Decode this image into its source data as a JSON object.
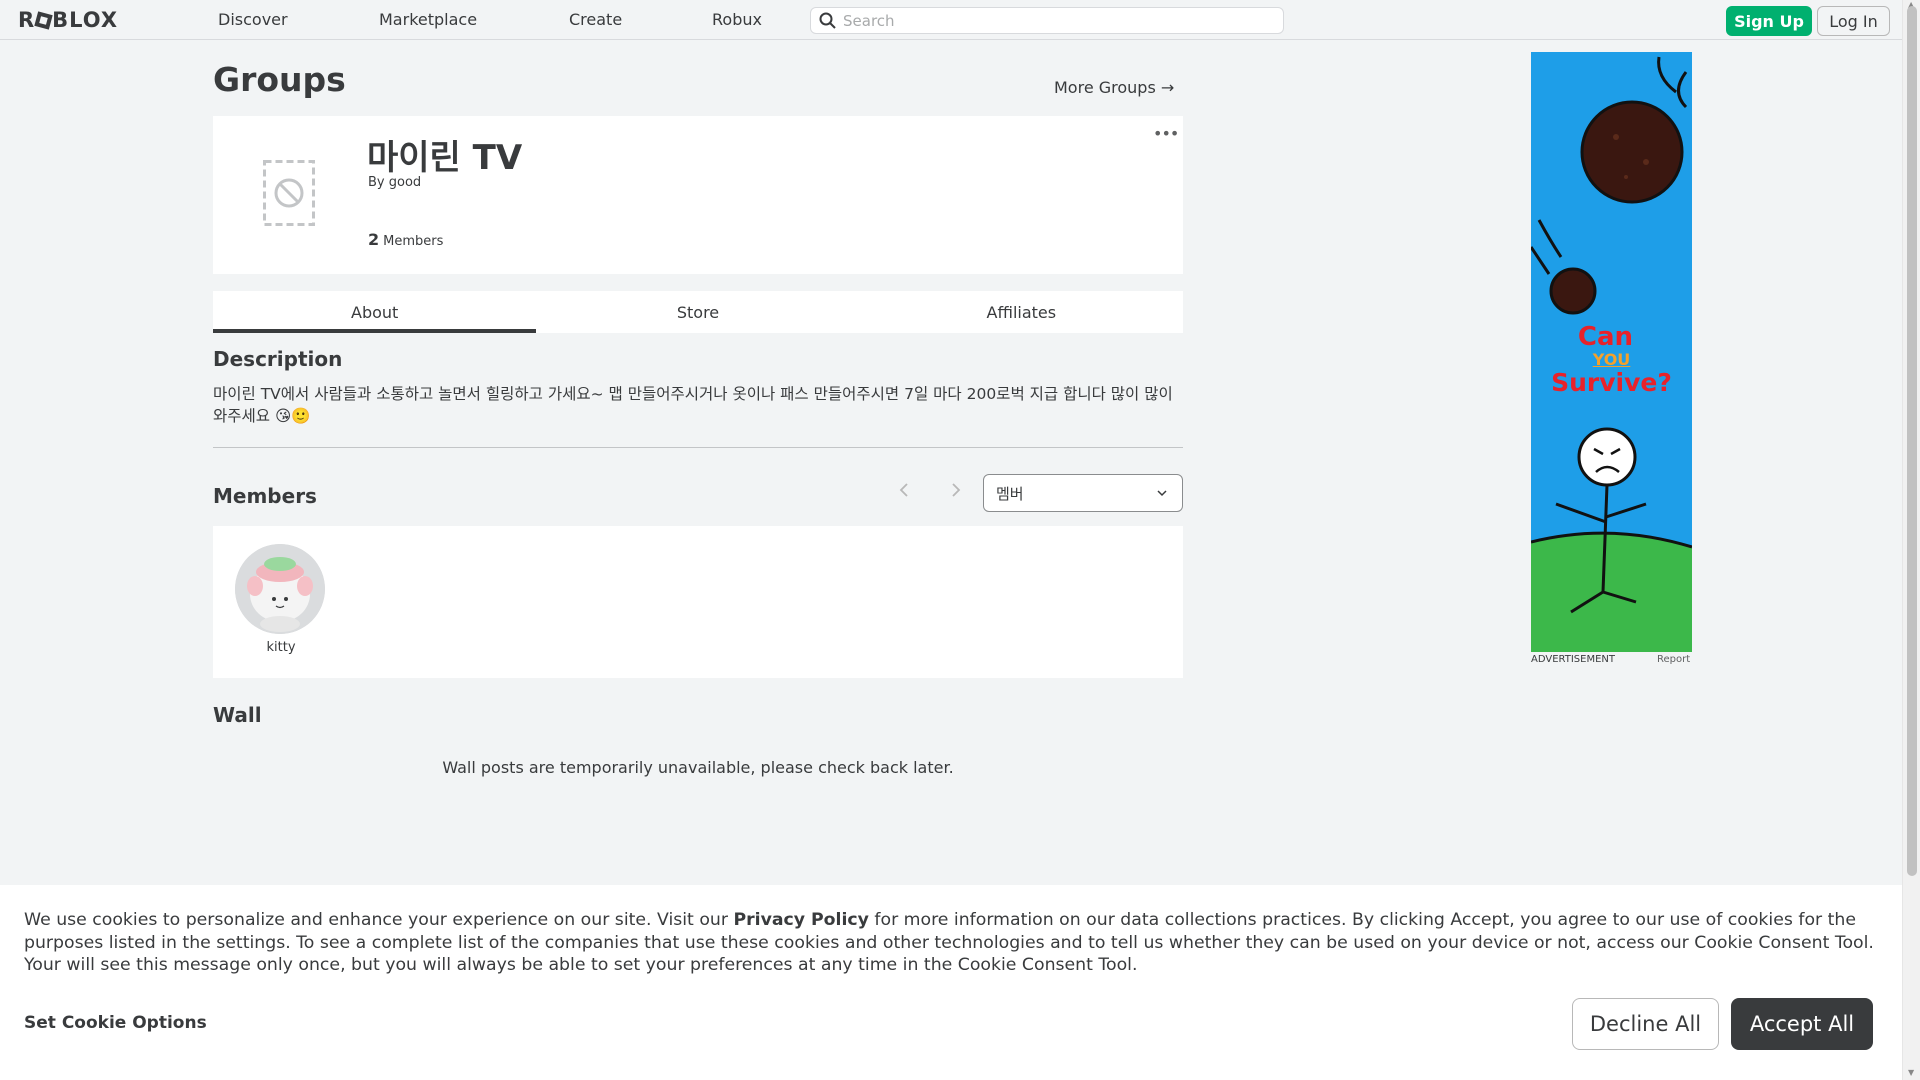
{
  "header": {
    "logo": "ROBLOX",
    "nav": [
      "Discover",
      "Marketplace",
      "Create",
      "Robux"
    ],
    "search_placeholder": "Search",
    "signup_label": "Sign Up",
    "login_label": "Log In"
  },
  "page": {
    "title": "Groups",
    "more_groups": "More Groups →"
  },
  "group": {
    "name": "마이린 TV",
    "by_label": "By",
    "owner": "good",
    "member_count": "2",
    "members_label": "Members"
  },
  "tabs": [
    "About",
    "Store",
    "Affiliates"
  ],
  "description": {
    "heading": "Description",
    "text": "마이린 TV에서 사람들과 소통하고 놀면서 힐링하고 가세요~ 맵 만들어주시거나 옷이나 패스 만들어주시면 7일 마다 200로벅 지급 합니다 많이 많이 와주세요 😘🙂"
  },
  "members": {
    "heading": "Members",
    "role_selected": "멤버",
    "list": [
      {
        "name": "kitty"
      }
    ]
  },
  "wall": {
    "heading": "Wall",
    "message": "Wall posts are temporarily unavailable, please check back later."
  },
  "ad": {
    "line1": "Can",
    "line2": "YOU",
    "line3": "Survive?",
    "label": "ADVERTISEMENT",
    "report": "Report"
  },
  "cookie": {
    "text_before": "We use cookies to personalize and enhance your experience on our site. Visit our ",
    "policy_link": "Privacy Policy",
    "text_after": " for more information on our data collections practices. By clicking Accept, you agree to our use of cookies for the purposes listed in the settings. To see a complete list of the companies that use these cookies and other technologies and to tell us whether they can be used on your device or not, access our Cookie Consent Tool. Your will see this message only once, but you will always be able to set your preferences at any time in the Cookie Consent Tool.",
    "set_options": "Set Cookie Options",
    "decline": "Decline All",
    "accept": "Accept All"
  }
}
